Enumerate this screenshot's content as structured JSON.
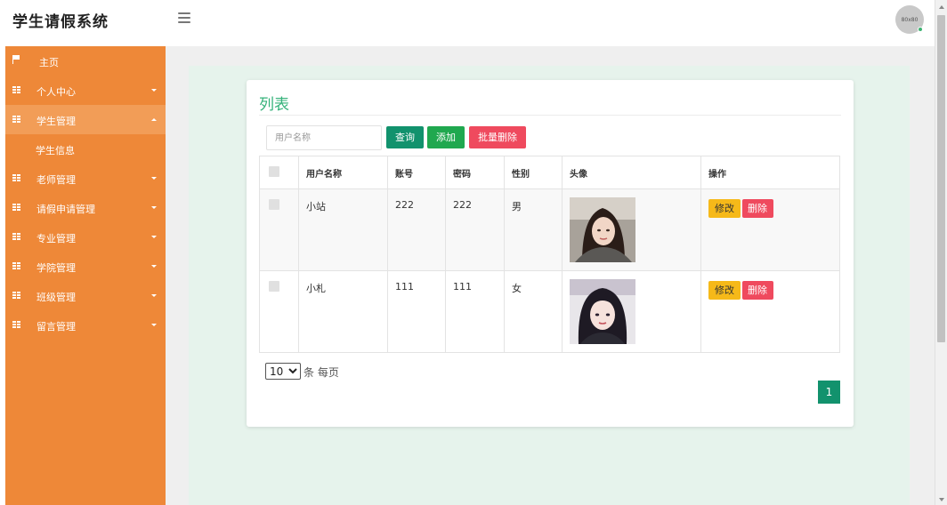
{
  "header": {
    "app_title": "学生请假系统",
    "avatar_text": "80x80",
    "menu_icon": "hamburger-icon"
  },
  "sidebar": {
    "accent": "#ee8838",
    "items": [
      {
        "label": "主页",
        "icon": "flag-icon"
      },
      {
        "label": "个人中心",
        "icon": "grid-icon"
      },
      {
        "label": "学生管理",
        "icon": "grid-icon",
        "expanded": true
      },
      {
        "label": "老师管理",
        "icon": "grid-icon"
      },
      {
        "label": "请假申请管理",
        "icon": "grid-icon"
      },
      {
        "label": "专业管理",
        "icon": "grid-icon"
      },
      {
        "label": "学院管理",
        "icon": "grid-icon"
      },
      {
        "label": "班级管理",
        "icon": "grid-icon"
      },
      {
        "label": "留言管理",
        "icon": "grid-icon"
      }
    ],
    "sub_items": [
      {
        "label": "学生信息"
      }
    ]
  },
  "main": {
    "card_title": "列表",
    "search": {
      "placeholder": "用户名称",
      "value": ""
    },
    "buttons": {
      "query": "查询",
      "add": "添加",
      "batch_delete": "批量删除"
    },
    "table": {
      "columns": [
        "用户名称",
        "账号",
        "密码",
        "性别",
        "头像",
        "操作"
      ],
      "rows": [
        {
          "username": "小站",
          "account": "222",
          "password": "222",
          "gender": "男",
          "avatar": "portrait-photo-1"
        },
        {
          "username": "小札",
          "account": "111",
          "password": "111",
          "gender": "女",
          "avatar": "portrait-photo-2"
        }
      ],
      "row_actions": {
        "edit": "修改",
        "delete": "删除"
      }
    },
    "pagination": {
      "page_size": "10",
      "page_size_options": [
        "10"
      ],
      "page_size_suffix": "条 每页",
      "current_page": "1"
    }
  },
  "colors": {
    "green_title": "#35b27a",
    "query": "#12926d",
    "add": "#20a84f",
    "danger": "#ef4a5e",
    "edit": "#f6b919"
  }
}
